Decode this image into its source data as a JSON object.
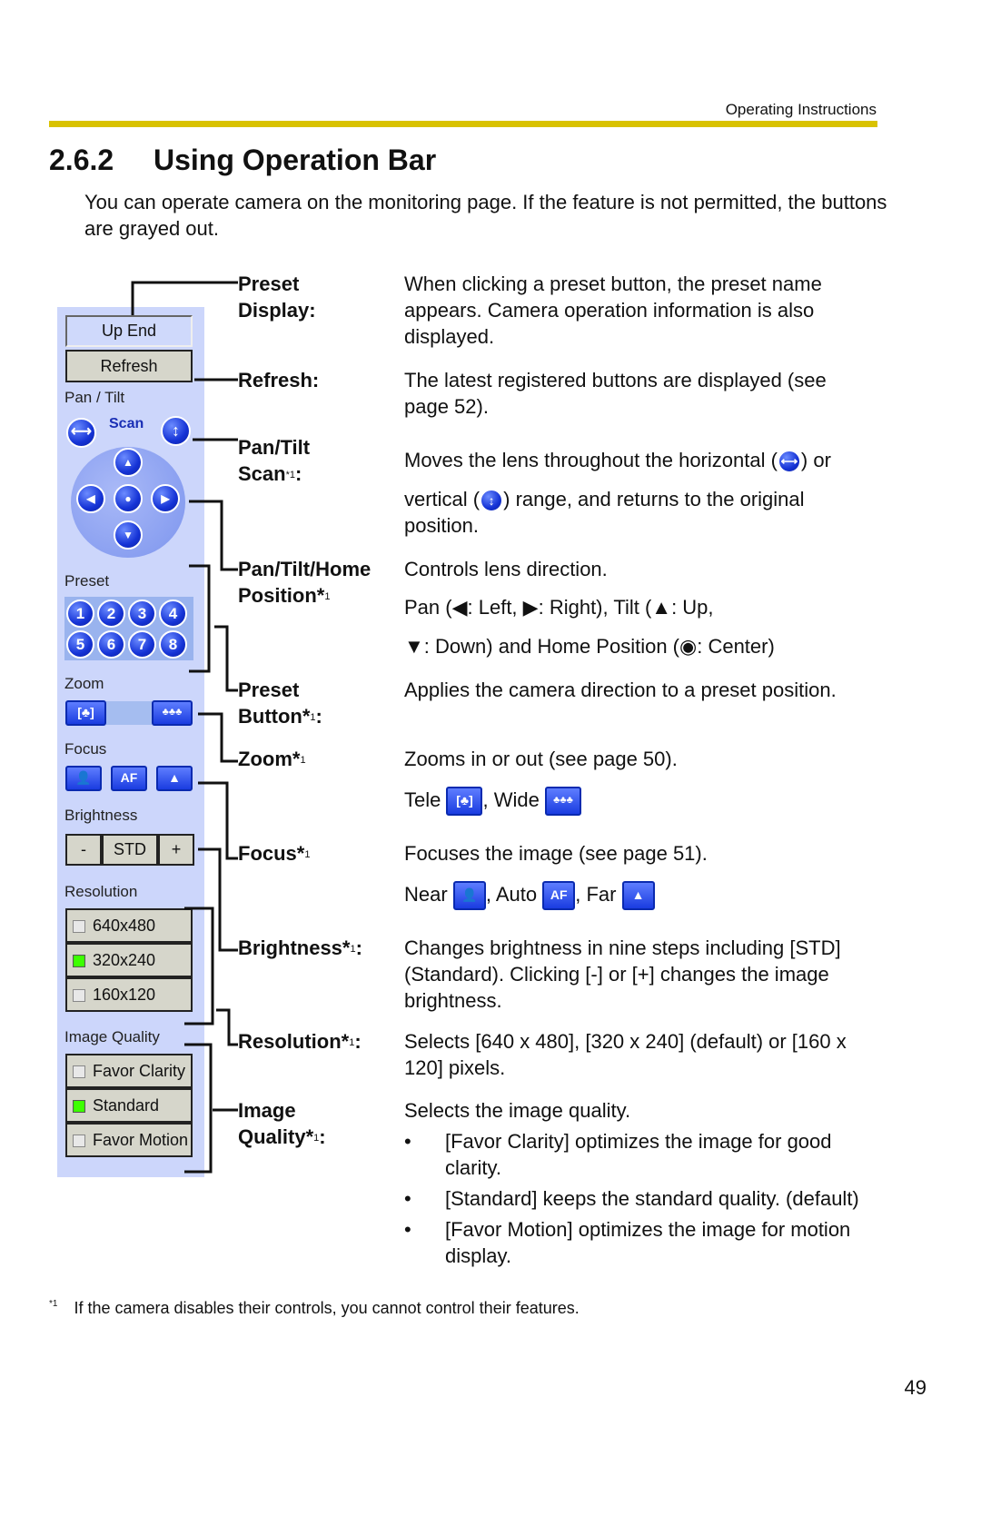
{
  "header": {
    "running_title": "Operating Instructions",
    "accent_color": "#d9c200"
  },
  "section": {
    "number": "2.6.2",
    "title": "Using Operation Bar"
  },
  "intro": "You can operate camera on the monitoring page. If the feature is not permitted, the buttons are grayed out.",
  "panel": {
    "preset_display": "Up End",
    "refresh": "Refresh",
    "pan_tilt_label": "Pan / Tilt",
    "scan_label": "Scan",
    "preset_label": "Preset",
    "preset_buttons": [
      "1",
      "2",
      "3",
      "4",
      "5",
      "6",
      "7",
      "8"
    ],
    "zoom_label": "Zoom",
    "focus_label": "Focus",
    "focus_af": "AF",
    "brightness_label": "Brightness",
    "brightness_minus": "-",
    "brightness_std": "STD",
    "brightness_plus": "+",
    "resolution_label": "Resolution",
    "resolutions": [
      {
        "label": "640x480",
        "selected": false
      },
      {
        "label": "320x240",
        "selected": true
      },
      {
        "label": "160x120",
        "selected": false
      }
    ],
    "quality_label": "Image Quality",
    "qualities": [
      {
        "label": "Favor Clarity",
        "selected": false
      },
      {
        "label": "Standard",
        "selected": true
      },
      {
        "label": "Favor Motion",
        "selected": false
      }
    ]
  },
  "items": {
    "preset_display": {
      "label1": "Preset",
      "label2": "Display:",
      "desc": [
        "When clicking a preset button, the preset name",
        "appears. Camera operation information is also",
        "displayed."
      ]
    },
    "refresh": {
      "label1": "Refresh:",
      "desc": [
        "The latest registered buttons are displayed (see",
        "page 52)."
      ]
    },
    "scan": {
      "label1": "Pan/Tilt",
      "label2": "Scan",
      "mark": "*1",
      "colon": ":",
      "desc1a": "Moves the lens throughout the horizontal (",
      "desc1b": ") or",
      "desc2a": "vertical (",
      "desc2b": ") range, and returns to the original",
      "desc3": "position."
    },
    "pan_tilt_home": {
      "label1": "Pan/Tilt/Home",
      "label2": "Position*",
      "mark": "1",
      "desc1": "Controls lens direction.",
      "desc2": [
        "Pan (",
        ": Left, ",
        ": Right), Tilt (",
        ": Up,"
      ],
      "desc3": [
        ": Down) and Home Position (",
        ": Center)"
      ]
    },
    "preset_button": {
      "label1": "Preset",
      "label2": "Button*",
      "mark": "1",
      "colon": ":",
      "desc": "Applies the camera direction to a preset position."
    },
    "zoom": {
      "label1": "Zoom*",
      "mark": "1",
      "desc": "Zooms in or out (see page 50).",
      "tele": "Tele",
      "wide": ", Wide"
    },
    "focus": {
      "label1": "Focus*",
      "mark": "1",
      "desc": "Focuses the image (see page 51).",
      "near": "Near",
      "auto": ", Auto",
      "far": ", Far"
    },
    "brightness": {
      "label1": "Brightness*",
      "mark": "1",
      "colon": ":",
      "desc": [
        "Changes brightness in nine steps including [STD]",
        "(Standard). Clicking [-] or [+] changes the image",
        "brightness."
      ]
    },
    "resolution": {
      "label1": "Resolution*",
      "mark": "1",
      "colon": ":",
      "desc": [
        "Selects [640 x 480], [320 x 240] (default) or [160 x",
        "120] pixels."
      ]
    },
    "image_quality": {
      "label1": "Image",
      "label2": "Quality*",
      "mark": "1",
      "colon": ":",
      "desc": "Selects the image quality.",
      "bullets": [
        [
          "[Favor Clarity] optimizes the image for good",
          "clarity."
        ],
        [
          "[Standard] keeps the standard quality. (default)"
        ],
        [
          "[Favor Motion] optimizes the image for motion",
          "display."
        ]
      ],
      "bullet_char": "•"
    }
  },
  "footnote": {
    "mark": "*1",
    "text": "If the camera disables their controls, you cannot control their features."
  },
  "page_number": "49"
}
